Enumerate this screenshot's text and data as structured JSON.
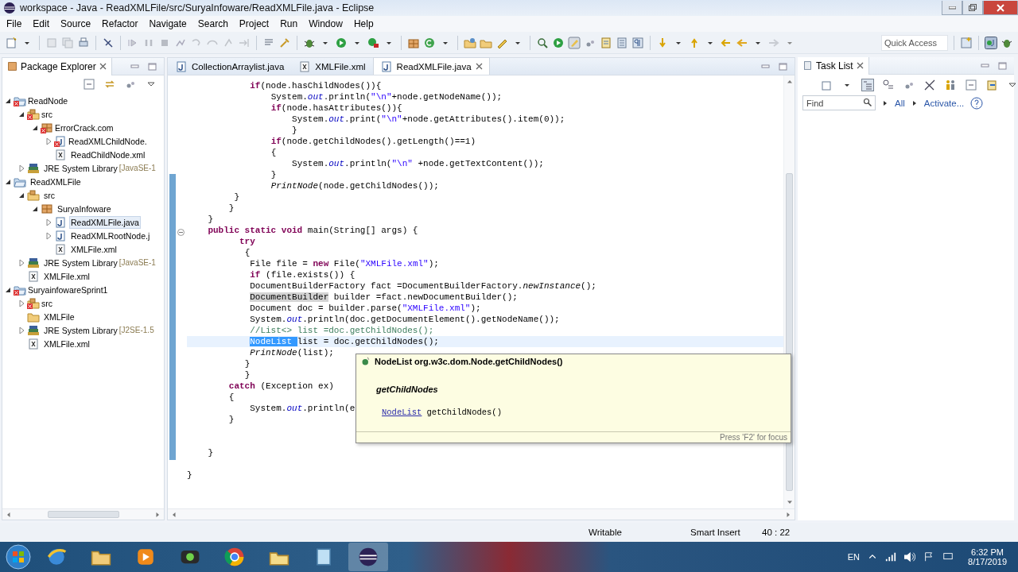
{
  "window": {
    "title": "workspace - Java - ReadXMLFile/src/SuryaInfoware/ReadXMLFile.java - Eclipse"
  },
  "menu": [
    "File",
    "Edit",
    "Source",
    "Refactor",
    "Navigate",
    "Search",
    "Project",
    "Run",
    "Window",
    "Help"
  ],
  "quick_access": {
    "placeholder": "Quick Access"
  },
  "package_explorer": {
    "title": "Package Explorer",
    "tree": [
      {
        "label": "ReadNode",
        "kind": "project",
        "error": true,
        "expanded": true,
        "selected": false,
        "children": [
          {
            "label": "src",
            "kind": "source",
            "error": true,
            "expanded": true,
            "selected": false,
            "children": [
              {
                "label": "ErrorCrack.com",
                "kind": "package",
                "error": true,
                "expanded": true,
                "selected": false,
                "children": [
                  {
                    "label": "ReadXMLChildNode.",
                    "kind": "java",
                    "error": true,
                    "expanded": false,
                    "selected": false
                  },
                  {
                    "label": "ReadChildNode.xml",
                    "kind": "xml",
                    "error": false,
                    "selected": false
                  }
                ]
              }
            ]
          },
          {
            "label": "JRE System Library",
            "decoration": "[JavaSE-1",
            "kind": "library",
            "error": false,
            "expanded": false,
            "selected": false
          }
        ]
      },
      {
        "label": "ReadXMLFile",
        "kind": "project",
        "error": false,
        "expanded": true,
        "selected": false,
        "children": [
          {
            "label": "src",
            "kind": "source",
            "error": false,
            "expanded": true,
            "selected": false,
            "children": [
              {
                "label": "SuryaInfoware",
                "kind": "package",
                "error": false,
                "expanded": true,
                "selected": false,
                "children": [
                  {
                    "label": "ReadXMLFile.java",
                    "kind": "java",
                    "error": false,
                    "expanded": false,
                    "selected": true
                  },
                  {
                    "label": "ReadXMLRootNode.j",
                    "kind": "java",
                    "error": false,
                    "expanded": false,
                    "selected": false
                  },
                  {
                    "label": "XMLFile.xml",
                    "kind": "xml",
                    "error": false,
                    "selected": false
                  }
                ]
              }
            ]
          },
          {
            "label": "JRE System Library",
            "decoration": "[JavaSE-1",
            "kind": "library",
            "error": false,
            "expanded": false,
            "selected": false
          },
          {
            "label": "XMLFile.xml",
            "kind": "xml",
            "error": false,
            "selected": false
          }
        ]
      },
      {
        "label": "SuryainfowareSprint1",
        "kind": "project",
        "error": true,
        "expanded": true,
        "selected": false,
        "children": [
          {
            "label": "src",
            "kind": "source",
            "error": true,
            "expanded": false,
            "selected": false
          },
          {
            "label": "XMLFile",
            "kind": "folder",
            "error": false,
            "selected": false
          },
          {
            "label": "JRE System Library",
            "decoration": "[J2SE-1.5",
            "kind": "library",
            "error": false,
            "expanded": false,
            "selected": false
          },
          {
            "label": "XMLFile.xml",
            "kind": "xml",
            "error": false,
            "selected": false
          }
        ]
      }
    ]
  },
  "editor": {
    "tabs": [
      {
        "label": "CollectionArraylist.java",
        "kind": "java",
        "selected": false
      },
      {
        "label": "XMLFile.xml",
        "kind": "xml",
        "selected": false
      },
      {
        "label": "ReadXMLFile.java",
        "kind": "java",
        "selected": true
      }
    ],
    "lines": [
      {
        "current": false,
        "tokens": [
          {
            "kind": "keyword",
            "text": "            if"
          },
          {
            "kind": "plain",
            "text": "(node.hasChildNodes()){"
          }
        ]
      },
      {
        "current": false,
        "tokens": [
          {
            "kind": "plain",
            "text": "                System."
          },
          {
            "kind": "field",
            "text": "out"
          },
          {
            "kind": "plain",
            "text": ".println("
          },
          {
            "kind": "string",
            "text": "\"\\n\""
          },
          {
            "kind": "plain",
            "text": "+node.getNodeName());"
          }
        ]
      },
      {
        "current": false,
        "tokens": [
          {
            "kind": "keyword",
            "text": "                if"
          },
          {
            "kind": "plain",
            "text": "(node.hasAttributes()){"
          }
        ]
      },
      {
        "current": false,
        "tokens": [
          {
            "kind": "plain",
            "text": "                    System."
          },
          {
            "kind": "field",
            "text": "out"
          },
          {
            "kind": "plain",
            "text": ".print("
          },
          {
            "kind": "string",
            "text": "\"\\n\""
          },
          {
            "kind": "plain",
            "text": "+node.getAttributes().item(0));"
          }
        ]
      },
      {
        "current": false,
        "tokens": [
          {
            "kind": "plain",
            "text": "                    }"
          }
        ]
      },
      {
        "current": false,
        "tokens": [
          {
            "kind": "keyword",
            "text": "                if"
          },
          {
            "kind": "plain",
            "text": "(node.getChildNodes().getLength()==1)"
          }
        ]
      },
      {
        "current": false,
        "tokens": [
          {
            "kind": "plain",
            "text": "                {"
          }
        ]
      },
      {
        "current": false,
        "tokens": [
          {
            "kind": "plain",
            "text": "                    System."
          },
          {
            "kind": "field",
            "text": "out"
          },
          {
            "kind": "plain",
            "text": ".println("
          },
          {
            "kind": "string",
            "text": "\"\\n\""
          },
          {
            "kind": "plain",
            "text": " +node.getTextContent());"
          }
        ]
      },
      {
        "current": false,
        "tokens": [
          {
            "kind": "plain",
            "text": "                }"
          }
        ]
      },
      {
        "current": false,
        "tokens": [
          {
            "kind": "static",
            "text": "                PrintNode"
          },
          {
            "kind": "plain",
            "text": "(node.getChildNodes());"
          }
        ]
      },
      {
        "current": false,
        "tokens": [
          {
            "kind": "plain",
            "text": "         }"
          }
        ]
      },
      {
        "current": false,
        "tokens": [
          {
            "kind": "plain",
            "text": "        }"
          }
        ]
      },
      {
        "current": false,
        "tokens": [
          {
            "kind": "plain",
            "text": "    }"
          }
        ]
      },
      {
        "current": false,
        "tokens": [
          {
            "kind": "keyword",
            "text": "    public static void"
          },
          {
            "kind": "plain",
            "text": " main(String[] args) {"
          }
        ]
      },
      {
        "current": false,
        "tokens": [
          {
            "kind": "keyword",
            "text": "          try"
          }
        ]
      },
      {
        "current": false,
        "tokens": [
          {
            "kind": "plain",
            "text": "           {"
          }
        ]
      },
      {
        "current": false,
        "tokens": [
          {
            "kind": "plain",
            "text": "            File file = "
          },
          {
            "kind": "keyword",
            "text": "new"
          },
          {
            "kind": "plain",
            "text": " File("
          },
          {
            "kind": "string",
            "text": "\"XMLFile.xml\""
          },
          {
            "kind": "plain",
            "text": ");"
          }
        ]
      },
      {
        "current": false,
        "tokens": [
          {
            "kind": "keyword",
            "text": "            if"
          },
          {
            "kind": "plain",
            "text": " (file.exists()) {"
          }
        ]
      },
      {
        "current": false,
        "tokens": [
          {
            "kind": "plain",
            "text": "            DocumentBuilderFactory fact =DocumentBuilderFactory."
          },
          {
            "kind": "static",
            "text": "newInstance"
          },
          {
            "kind": "plain",
            "text": "();"
          }
        ]
      },
      {
        "current": false,
        "tokens": [
          {
            "kind": "occurrence",
            "text": "            DocumentBuilder"
          },
          {
            "kind": "plain",
            "text": " builder =fact.newDocumentBuilder();"
          }
        ]
      },
      {
        "current": false,
        "tokens": [
          {
            "kind": "plain",
            "text": "            Document doc = builder.parse("
          },
          {
            "kind": "string",
            "text": "\"XMLFile.xml\""
          },
          {
            "kind": "plain",
            "text": ");"
          }
        ]
      },
      {
        "current": false,
        "tokens": [
          {
            "kind": "plain",
            "text": "            System."
          },
          {
            "kind": "field",
            "text": "out"
          },
          {
            "kind": "plain",
            "text": ".println(doc.getDocumentElement().getNodeName());"
          }
        ]
      },
      {
        "current": false,
        "tokens": [
          {
            "kind": "comment",
            "text": "            //List<> list =doc.getChildNodes();"
          }
        ]
      },
      {
        "current": true,
        "tokens": [
          {
            "kind": "selected",
            "text": "            NodeList "
          },
          {
            "kind": "plain",
            "text": "list = doc.getChildNodes();"
          }
        ]
      },
      {
        "current": false,
        "tokens": [
          {
            "kind": "static",
            "text": "            PrintNode"
          },
          {
            "kind": "plain",
            "text": "(list);"
          }
        ]
      },
      {
        "current": false,
        "tokens": [
          {
            "kind": "plain",
            "text": "           }"
          }
        ]
      },
      {
        "current": false,
        "tokens": [
          {
            "kind": "plain",
            "text": "           }"
          }
        ]
      },
      {
        "current": false,
        "tokens": [
          {
            "kind": "keyword",
            "text": "        catch"
          },
          {
            "kind": "plain",
            "text": " (Exception ex)"
          }
        ]
      },
      {
        "current": false,
        "tokens": [
          {
            "kind": "plain",
            "text": "        {"
          }
        ]
      },
      {
        "current": false,
        "tokens": [
          {
            "kind": "plain",
            "text": "            System."
          },
          {
            "kind": "field",
            "text": "out"
          },
          {
            "kind": "plain",
            "text": ".println(e"
          }
        ]
      },
      {
        "current": false,
        "tokens": [
          {
            "kind": "plain",
            "text": "        }"
          }
        ]
      },
      {
        "current": false
      },
      {
        "current": false
      },
      {
        "current": false,
        "tokens": [
          {
            "kind": "plain",
            "text": "    }"
          }
        ]
      },
      {
        "current": false
      },
      {
        "current": false,
        "tokens": [
          {
            "kind": "plain",
            "text": "}"
          }
        ]
      }
    ],
    "hover": {
      "signature": "NodeList org.w3c.dom.Node.getChildNodes()",
      "method": "getChildNodes",
      "return_type": "NodeList",
      "declaration": "getChildNodes()",
      "hint": "Press 'F2' for focus"
    }
  },
  "task_list": {
    "title": "Task List",
    "find": {
      "placeholder": "Find"
    },
    "links": [
      "All",
      "Activate..."
    ]
  },
  "status_bar": {
    "mode": "Writable",
    "insert_mode": "Smart Insert",
    "position": "40 : 22"
  },
  "taskbar": {
    "language": "EN",
    "time": "6:32 PM",
    "date": "8/17/2019"
  }
}
